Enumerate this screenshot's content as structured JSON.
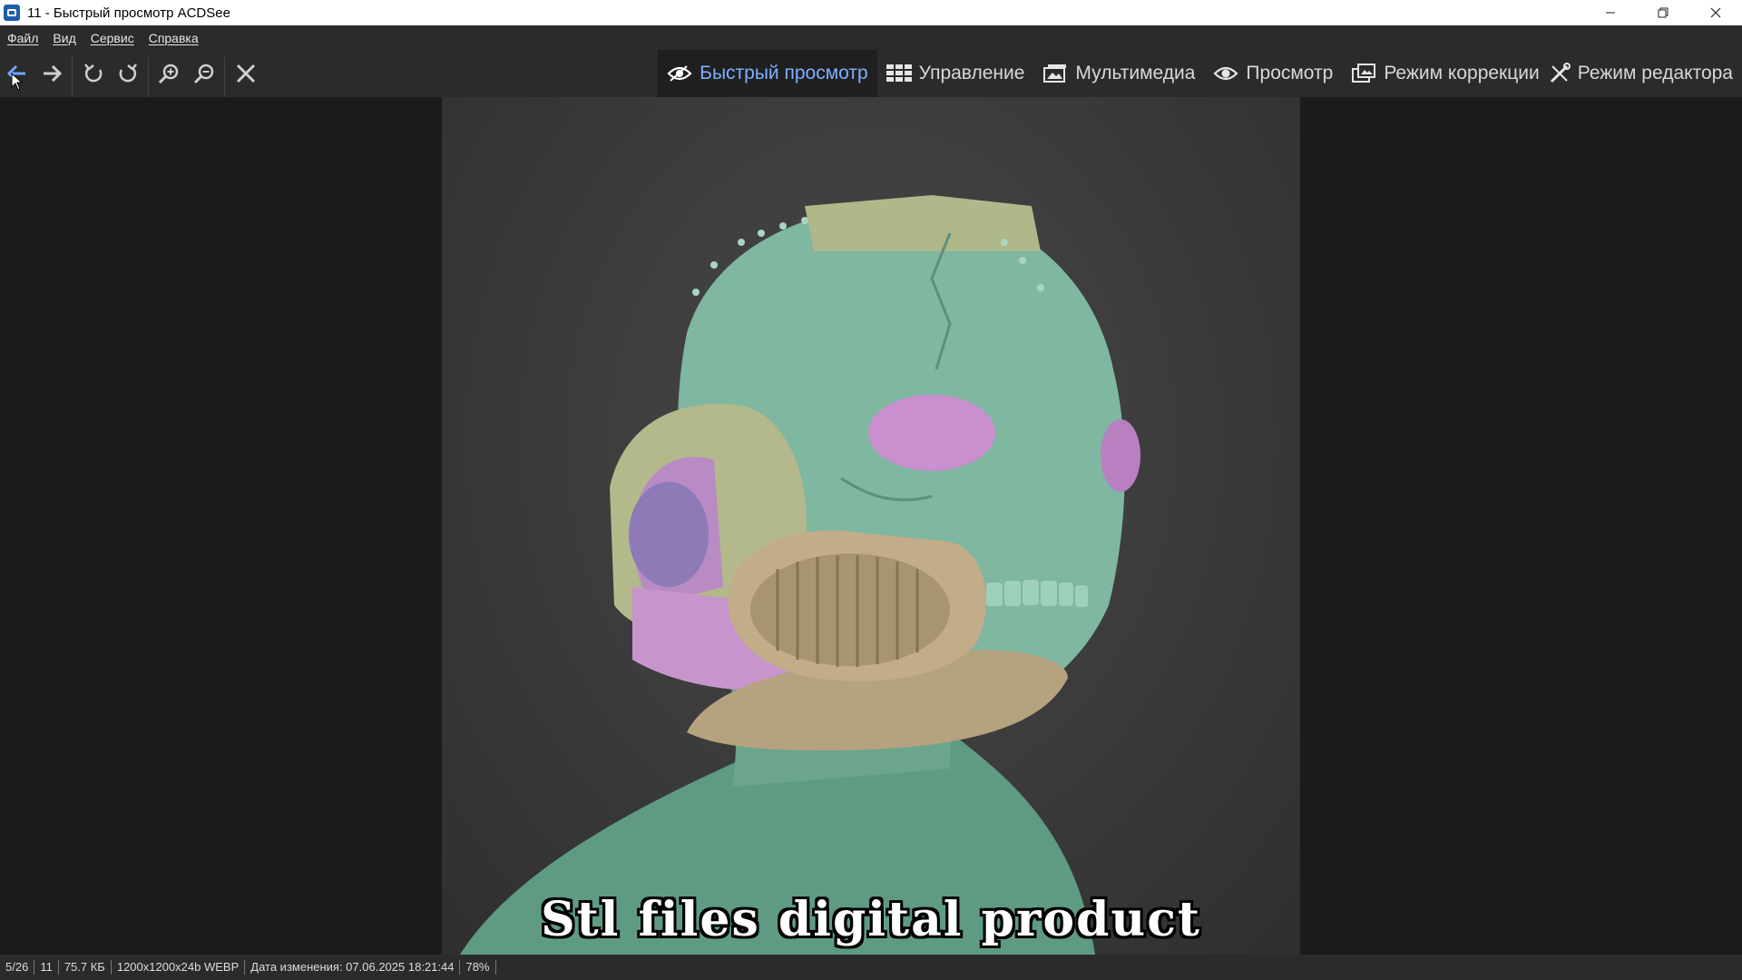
{
  "window": {
    "title": "11 - Быстрый просмотр ACDSee"
  },
  "menu": {
    "items": [
      "Файл",
      "Вид",
      "Сервис",
      "Справка"
    ]
  },
  "toolbar": {
    "buttons": [
      "back-arrow-icon",
      "forward-arrow-icon",
      "rotate-left-icon",
      "rotate-right-icon",
      "zoom-in-icon",
      "zoom-out-icon",
      "close-icon"
    ]
  },
  "tabs": [
    {
      "label": "Быстрый просмотр",
      "icon": "quick-view-eye-icon",
      "active": true
    },
    {
      "label": "Управление",
      "icon": "grid-icon",
      "active": false
    },
    {
      "label": "Мультимедиа",
      "icon": "media-icon",
      "active": false
    },
    {
      "label": "Просмотр",
      "icon": "eye-icon",
      "active": false
    },
    {
      "label": "Режим коррекции",
      "icon": "develop-icon",
      "active": false
    },
    {
      "label": "Режим редактора",
      "icon": "edit-icon",
      "active": false
    }
  ],
  "image": {
    "caption": "Stl files digital product"
  },
  "status": {
    "position": "5/26",
    "name": "11",
    "size": "75.7 КБ",
    "dimensions": "1200x1200x24b WEBP",
    "modified": "Дата изменения: 07.06.2025 18:21:44",
    "zoom": "78%"
  },
  "colors": {
    "accent": "#7fb0ff",
    "background": "#1b1b1b",
    "toolbar": "#2b2b2b"
  }
}
